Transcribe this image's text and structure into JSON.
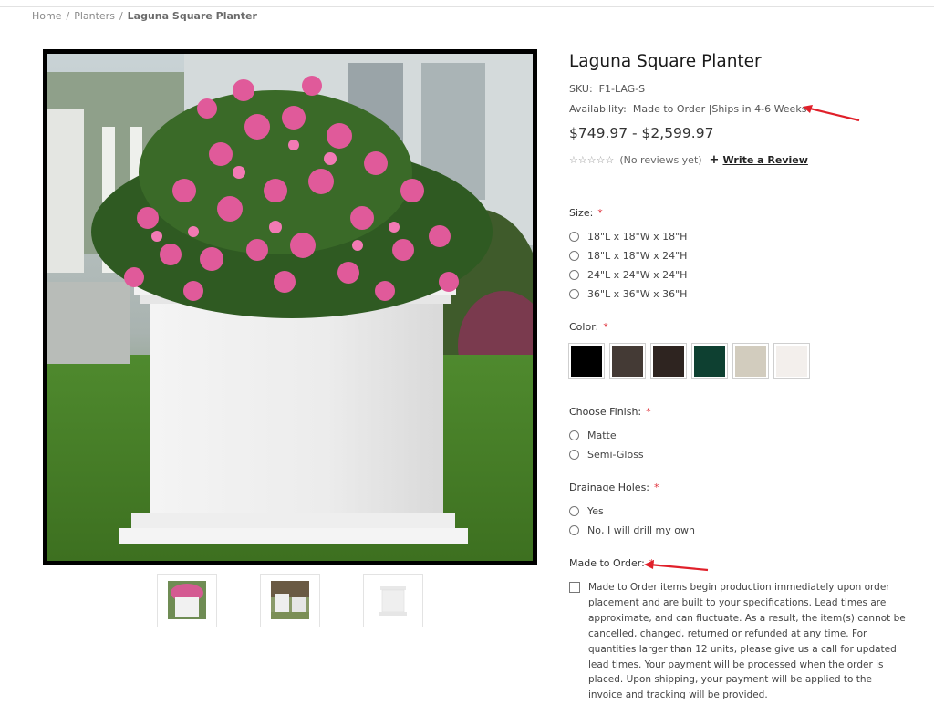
{
  "breadcrumb": {
    "home": "Home",
    "planters": "Planters",
    "current": "Laguna Square Planter"
  },
  "product": {
    "title": "Laguna Square Planter",
    "sku_label": "SKU:",
    "sku": "F1-LAG-S",
    "availability_label": "Availability:",
    "availability": "Made to Order |Ships in 4-6 Weeks",
    "price": "$749.97 - $2,599.97",
    "stars": "☆☆☆☆☆",
    "reviews_text": "(No reviews yet)",
    "write_review": "Write a Review"
  },
  "size": {
    "label": "Size:",
    "required": "*",
    "options": [
      "18\"L x 18\"W x 18\"H",
      "18\"L x 18\"W x 24\"H",
      "24\"L x 24\"W x 24\"H",
      "36\"L x 36\"W x 36\"H"
    ]
  },
  "color": {
    "label": "Color:",
    "required": "*",
    "swatches": [
      "#000000",
      "#443a35",
      "#2e2420",
      "#0e4031",
      "#d2ccbe",
      "#f3efec"
    ]
  },
  "finish": {
    "label": "Choose Finish:",
    "required": "*",
    "options": [
      "Matte",
      "Semi-Gloss"
    ]
  },
  "drainage": {
    "label": "Drainage Holes:",
    "required": "*",
    "options": [
      "Yes",
      "No, I will drill my own"
    ]
  },
  "made_to_order": {
    "label": "Made to Order:",
    "required": "*",
    "notice": "Made to Order items begin production immediately upon order placement and are built to your specifications. Lead times are approximate, and can fluctuate. As a result, the item(s) cannot be cancelled, changed, returned or refunded at any time. For quantities larger than 12 units, please give us a call for updated lead times. Your payment will be processed when the order is placed. Upon shipping, your payment will be applied to the invoice and tracking will be provided."
  },
  "colors": {
    "annotation_arrow": "#e0202a",
    "required": "#e0323c",
    "flowers": "#e05a9a"
  }
}
